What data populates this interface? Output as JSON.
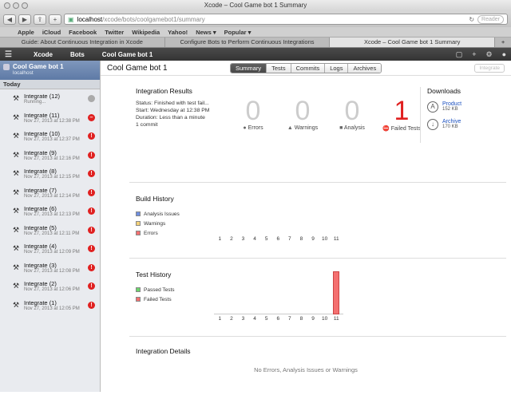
{
  "window": {
    "title": "Xcode – Cool Game bot 1 Summary"
  },
  "browser": {
    "url_host": "localhost",
    "url_path": "/xcode/bots/coolgamebot1/summary",
    "reader_label": "Reader",
    "bookmarks": [
      "Apple",
      "iCloud",
      "Facebook",
      "Twitter",
      "Wikipedia",
      "Yahoo!",
      "News ▾",
      "Popular ▾"
    ],
    "tabs": [
      {
        "label": "Guide: About Continuous Integration in Xcode"
      },
      {
        "label": "Configure Bots to Perform Continuous Integrations"
      },
      {
        "label": "Xcode – Cool Game bot 1 Summary"
      }
    ]
  },
  "xcode_bar": {
    "items": [
      "Xcode",
      "Bots",
      "Cool Game bot 1"
    ]
  },
  "sidebar": {
    "bot_name": "Cool Game bot 1",
    "bot_host": "localhost",
    "section": "Today",
    "items": [
      {
        "label": "Integrate (12)",
        "date": "Running...",
        "status": "running"
      },
      {
        "label": "Integrate (11)",
        "date": "Nov 27, 2013 at 12:38 PM",
        "status": "failed"
      },
      {
        "label": "Integrate (10)",
        "date": "Nov 27, 2013 at 12:37 PM",
        "status": "error"
      },
      {
        "label": "Integrate (9)",
        "date": "Nov 27, 2013 at 12:16 PM",
        "status": "error"
      },
      {
        "label": "Integrate (8)",
        "date": "Nov 27, 2013 at 12:15 PM",
        "status": "error"
      },
      {
        "label": "Integrate (7)",
        "date": "Nov 27, 2013 at 12:14 PM",
        "status": "error"
      },
      {
        "label": "Integrate (6)",
        "date": "Nov 27, 2013 at 12:13 PM",
        "status": "error"
      },
      {
        "label": "Integrate (5)",
        "date": "Nov 27, 2013 at 12:11 PM",
        "status": "error"
      },
      {
        "label": "Integrate (4)",
        "date": "Nov 27, 2013 at 12:09 PM",
        "status": "error"
      },
      {
        "label": "Integrate (3)",
        "date": "Nov 27, 2013 at 12:08 PM",
        "status": "error"
      },
      {
        "label": "Integrate (2)",
        "date": "Nov 27, 2013 at 12:06 PM",
        "status": "error"
      },
      {
        "label": "Integrate (1)",
        "date": "Nov 27, 2013 at 12:05 PM",
        "status": "error"
      }
    ]
  },
  "header": {
    "title": "Cool Game bot 1",
    "tabs": [
      "Summary",
      "Tests",
      "Commits",
      "Logs",
      "Archives"
    ],
    "active_tab": "Summary",
    "integrate_label": "Integrate"
  },
  "results": {
    "heading": "Integration Results",
    "status": "Status:  Finished with test fail...",
    "start": "Start:  Wednesday at 12:38 PM",
    "duration": "Duration:  Less than a minute",
    "commits": "1 commit",
    "counters": [
      {
        "value": "0",
        "label": "Errors",
        "icon": "error-icon"
      },
      {
        "value": "0",
        "label": "Warnings",
        "icon": "warning-icon"
      },
      {
        "value": "0",
        "label": "Analysis",
        "icon": "analysis-icon"
      },
      {
        "value": "1",
        "label": "Failed Tests",
        "icon": "failed-icon"
      }
    ]
  },
  "downloads": {
    "heading": "Downloads",
    "items": [
      {
        "name": "Product",
        "size": "152 KB",
        "icon": "app-store-icon"
      },
      {
        "name": "Archive",
        "size": "170 KB",
        "icon": "download-icon"
      }
    ]
  },
  "build_history": {
    "heading": "Build History",
    "legend": [
      {
        "label": "Analysis Issues",
        "color": "#6f8fe0"
      },
      {
        "label": "Warnings",
        "color": "#f4d27a"
      },
      {
        "label": "Errors",
        "color": "#f47070"
      }
    ],
    "x": [
      "1",
      "2",
      "3",
      "4",
      "5",
      "6",
      "7",
      "8",
      "9",
      "10",
      "11"
    ]
  },
  "test_history": {
    "heading": "Test History",
    "legend": [
      {
        "label": "Passed Tests",
        "color": "#6cd46c"
      },
      {
        "label": "Failed Tests",
        "color": "#f47070"
      }
    ],
    "x": [
      "1",
      "2",
      "3",
      "4",
      "5",
      "6",
      "7",
      "8",
      "9",
      "10",
      "11"
    ],
    "failed_values": [
      0,
      0,
      0,
      0,
      0,
      0,
      0,
      0,
      0,
      0,
      1
    ]
  },
  "details": {
    "heading": "Integration Details",
    "empty_text": "No Errors, Analysis Issues or Warnings"
  }
}
